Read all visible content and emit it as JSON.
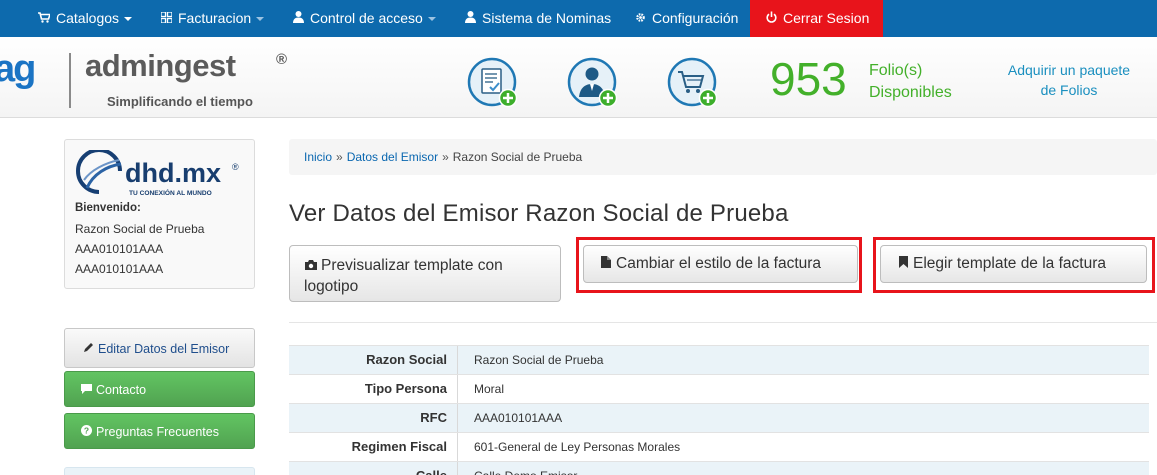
{
  "nav": {
    "items": [
      {
        "label": "Catalogos",
        "icon": "cart-icon",
        "dropdown": true
      },
      {
        "label": "Facturacion",
        "icon": "grid-icon",
        "dropdown": true
      },
      {
        "label": "Control de acceso",
        "icon": "user-icon",
        "dropdown": true
      },
      {
        "label": "Sistema de Nominas",
        "icon": "user-icon",
        "dropdown": false
      },
      {
        "label": "Configuración",
        "icon": "gear-icon",
        "dropdown": false
      }
    ],
    "logout": "Cerrar Sesion",
    "colors": {
      "bar": "#0d6aad",
      "logout": "#e8141b"
    }
  },
  "header": {
    "logo_mark": "ag",
    "logo_name": "admingest",
    "logo_reg": "®",
    "logo_tagline": "Simplificando el tiempo",
    "icons": [
      "new-invoice-icon",
      "new-client-icon",
      "new-cart-icon"
    ],
    "folios_count": "953",
    "folios_label_1": "Folio(s)",
    "folios_label_2": "Disponibles",
    "acquire_line_1": "Adquirir un paquete",
    "acquire_line_2": "de Folios"
  },
  "sidebar": {
    "company_logo_text": "dhd.mx",
    "company_logo_reg": "®",
    "company_logo_tagline": "TU CONEXIÓN AL MUNDO",
    "welcome": "Bienvenido:",
    "name": "Razon Social de Prueba",
    "rfc_1": "AAA010101AAA",
    "rfc_2": "AAA010101AAA",
    "edit_label": "Editar Datos del Emisor",
    "contact_label": "Contacto",
    "faq_label": "Preguntas Frecuentes"
  },
  "breadcrumb": {
    "home": "Inicio",
    "sep": "»",
    "issuer": "Datos del Emisor",
    "current": "Razon Social de Prueba"
  },
  "main": {
    "title": "Ver Datos del Emisor Razon Social de Prueba",
    "preview_label": "Previsualizar template con logotipo",
    "style_label": "Cambiar el estilo de la factura",
    "template_label": "Elegir template de la factura",
    "highlight_color": "#e8141b"
  },
  "details": [
    {
      "key": "Razon Social",
      "value": "Razon Social de Prueba"
    },
    {
      "key": "Tipo Persona",
      "value": "Moral"
    },
    {
      "key": "RFC",
      "value": "AAA010101AAA"
    },
    {
      "key": "Regimen Fiscal",
      "value": "601-General de Ley Personas Morales"
    },
    {
      "key": "Calle",
      "value": "Calle Demo Emisor"
    }
  ]
}
